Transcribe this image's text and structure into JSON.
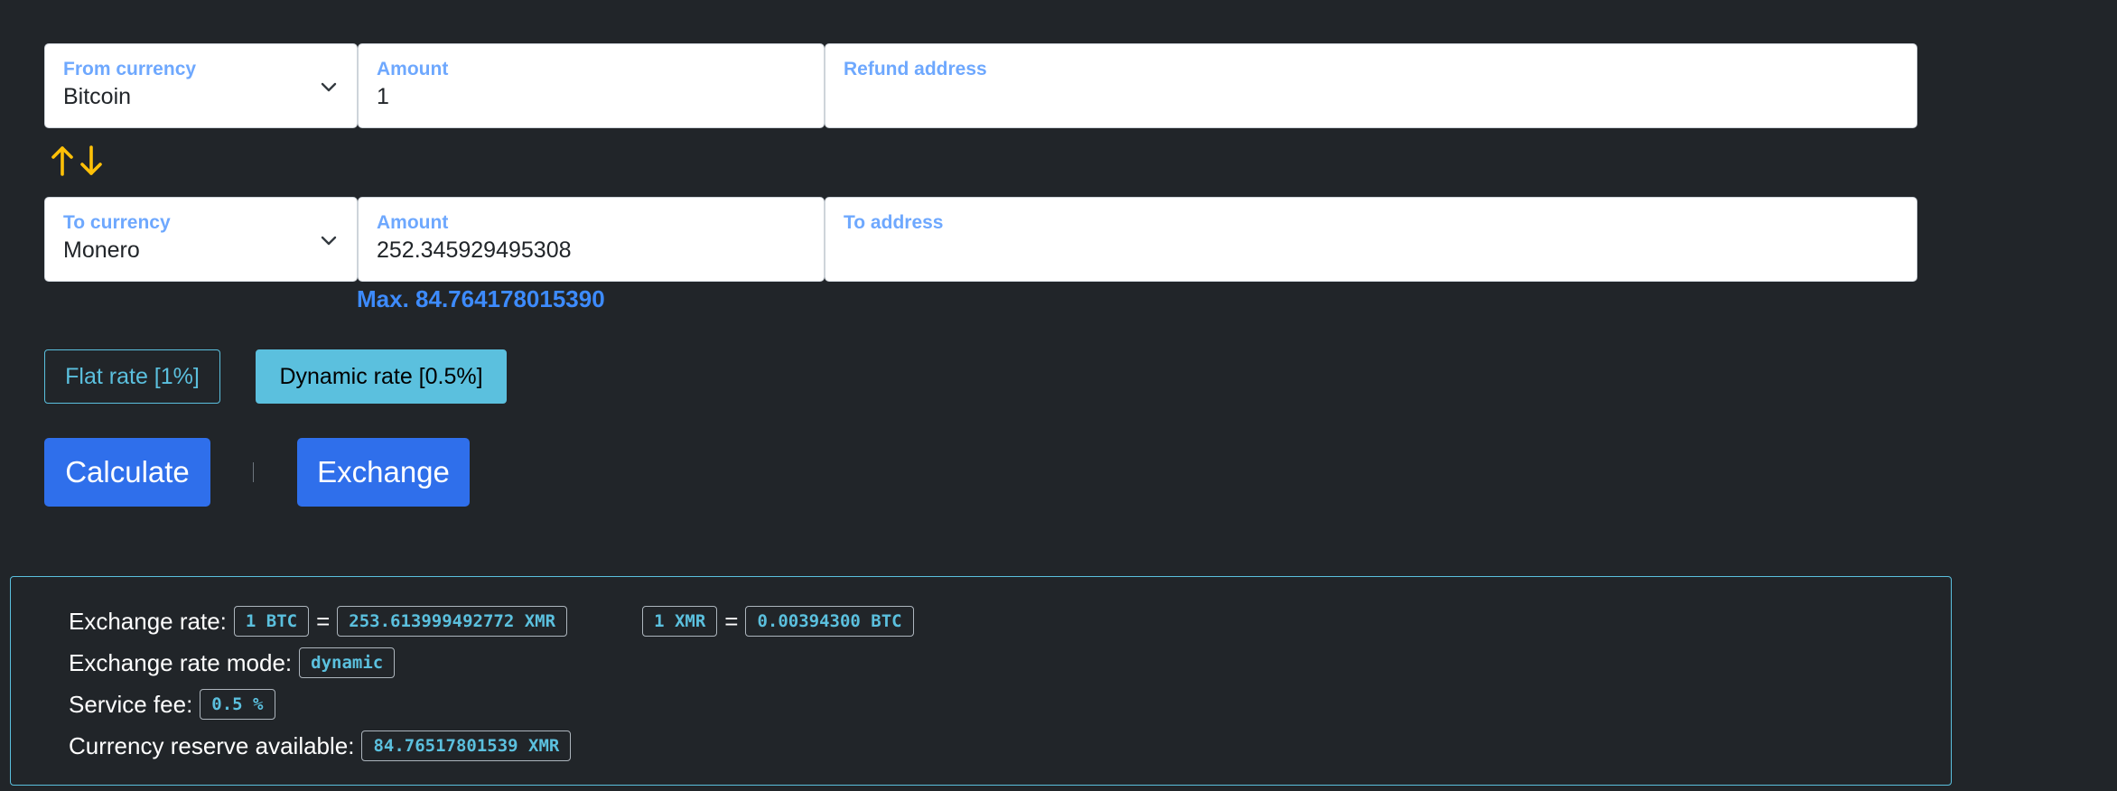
{
  "from": {
    "currency_label": "From currency",
    "currency_value": "Bitcoin",
    "amount_label": "Amount",
    "amount_value": "1",
    "address_label": "Refund address"
  },
  "swap_icon": "up-down-arrows-icon",
  "to": {
    "currency_label": "To currency",
    "currency_value": "Monero",
    "amount_label": "Amount",
    "amount_value": "252.345929495308",
    "address_label": "To address",
    "max_text": "Max. 84.764178015390"
  },
  "rates": {
    "flat_label": "Flat rate [1%]",
    "dynamic_label": "Dynamic rate [0.5%]",
    "selected": "dynamic"
  },
  "actions": {
    "calculate_label": "Calculate",
    "exchange_label": "Exchange"
  },
  "info": {
    "exchange_rate_label": "Exchange rate:",
    "rate_from_unit": "1 BTC",
    "rate_to_value": "253.613999492772 XMR",
    "inverse_from_unit": "1 XMR",
    "inverse_to_value": "0.00394300 BTC",
    "equals": "=",
    "mode_label": "Exchange rate mode:",
    "mode_value": "dynamic",
    "fee_label": "Service fee:",
    "fee_value": "0.5 %",
    "reserve_label": "Currency reserve available:",
    "reserve_value": "84.76517801539 XMR"
  },
  "colors": {
    "background": "#212529",
    "accent_blue": "#2f6feb",
    "info_cyan": "#5bc0de",
    "label_blue": "#6ea8fe",
    "swap_yellow": "#ffc107"
  }
}
